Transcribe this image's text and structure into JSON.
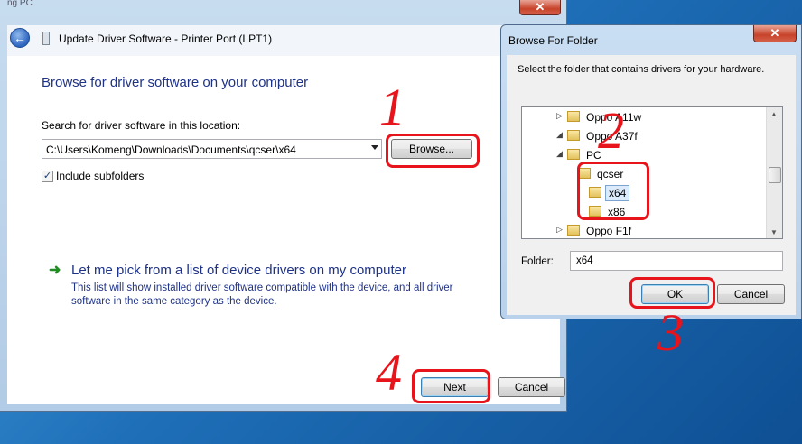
{
  "background_window": {
    "caption": "ng PC"
  },
  "wizard": {
    "title": "Update Driver Software - Printer Port (LPT1)",
    "heading": "Browse for driver software on your computer",
    "search_label": "Search for driver software in this location:",
    "path_value": "C:\\Users\\Komeng\\Downloads\\Documents\\qcser\\x64",
    "browse_label": "Browse...",
    "include_subfolders_label": "Include subfolders",
    "include_subfolders_checked": true,
    "pick_link": "Let me pick from a list of device drivers on my computer",
    "pick_description": "This list will show installed driver software compatible with the device, and all driver software in the same category as the device.",
    "next_label": "Next",
    "cancel_label": "Cancel"
  },
  "browse_dialog": {
    "title": "Browse For Folder",
    "description": "Select the folder that contains drivers for your hardware.",
    "tree": [
      {
        "label": "Oppo A11w",
        "expander": "▷",
        "level": 1
      },
      {
        "label": "Oppo A37f",
        "expander": "◢",
        "level": 1
      },
      {
        "label": "PC",
        "expander": "◢",
        "level": 2
      },
      {
        "label": "qcser",
        "expander": "",
        "level": 3
      },
      {
        "label": "x64",
        "expander": "",
        "level": 4,
        "selected": true
      },
      {
        "label": "x86",
        "expander": "",
        "level": 4
      },
      {
        "label": "Oppo F1f",
        "expander": "▷",
        "level": 1
      }
    ],
    "folder_label": "Folder:",
    "folder_value": "x64",
    "ok_label": "OK",
    "cancel_label": "Cancel"
  },
  "annotations": [
    "1",
    "2",
    "3",
    "4"
  ],
  "colors": {
    "annotation": "#e8141b",
    "link": "#1e3287",
    "close_button": "#c7432a"
  }
}
